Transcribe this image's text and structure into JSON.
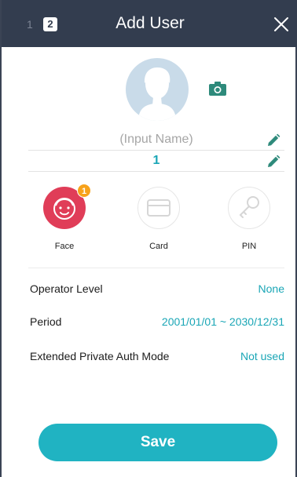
{
  "header": {
    "step_inactive": "1",
    "step_active": "2",
    "title": "Add User"
  },
  "profile": {
    "name_placeholder": "(Input Name)",
    "user_id": "1"
  },
  "auth_methods": [
    {
      "label": "Face",
      "badge": "1",
      "icon": "face-icon"
    },
    {
      "label": "Card",
      "icon": "card-icon"
    },
    {
      "label": "PIN",
      "icon": "key-icon"
    }
  ],
  "settings": [
    {
      "label": "Operator Level",
      "value": "None"
    },
    {
      "label": "Period",
      "value": "2001/01/01 ~ 2030/12/31"
    },
    {
      "label": "Extended Private Auth Mode",
      "value": "Not used"
    }
  ],
  "save_label": "Save",
  "colors": {
    "header_bg": "#333d4f",
    "accent": "#20b3c2",
    "face": "#e03d58",
    "badge": "#f7a21b"
  }
}
